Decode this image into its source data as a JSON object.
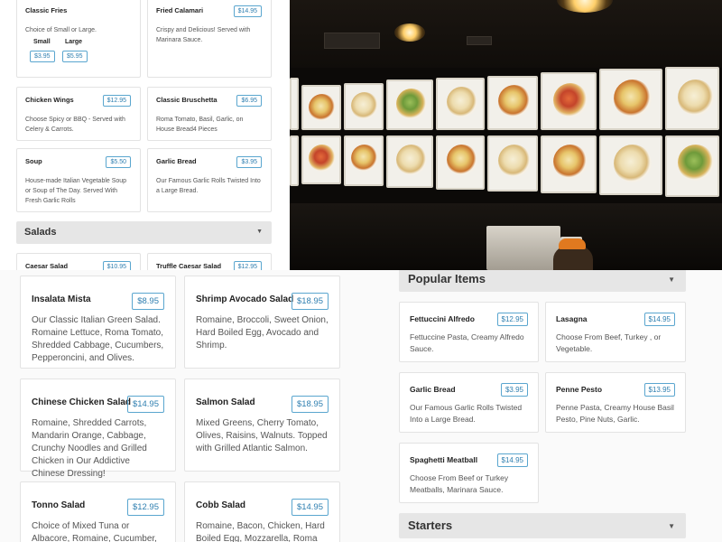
{
  "top_left": {
    "cards": [
      {
        "name": "Classic Fries",
        "price": "",
        "desc": "Choice of Small or Large.",
        "sizes": [
          {
            "label": "Small",
            "price": "$3.95"
          },
          {
            "label": "Large",
            "price": "$5.95"
          }
        ]
      },
      {
        "name": "Fried Calamari",
        "price": "$14.95",
        "desc": "Crispy and Delicious! Served with Marinara Sauce."
      },
      {
        "name": "Chicken Wings",
        "price": "$12.95",
        "desc": "Choose Spicy or BBQ - Served with Celery & Carrots."
      },
      {
        "name": "Classic Bruschetta",
        "price": "$6.95",
        "desc": "Roma Tomato, Basil, Garlic, on House Bread4 Pieces"
      },
      {
        "name": "Soup",
        "price": "$5.50",
        "desc": "House-made Italian Vegetable Soup or Soup of The Day. Served With Fresh Garlic Rolls"
      },
      {
        "name": "Garlic Bread",
        "price": "$3.95",
        "desc": "Our Famous Garlic Rolls Twisted Into a Large Bread."
      },
      {
        "name": "Caesar Salad",
        "price": "$10.95",
        "desc": ""
      },
      {
        "name": "Truffle Caesar Salad",
        "price": "$12.95",
        "desc": ""
      }
    ],
    "section": {
      "label": "Salads",
      "chevron": "▼"
    }
  },
  "photo": {
    "description_icon": "restaurant-menu-board-photo"
  },
  "bottom_left": {
    "cards": [
      {
        "name": "Insalata Mista",
        "price": "$8.95",
        "desc": "Our Classic Italian Green Salad. Romaine Lettuce, Roma Tomato, Shredded Cabbage, Cucumbers, Pepperoncini, and Olives."
      },
      {
        "name": "Shrimp Avocado Salad",
        "price": "$18.95",
        "desc": "Romaine, Broccoli, Sweet Onion, Hard Boiled Egg, Avocado and Shrimp."
      },
      {
        "name": "Chinese Chicken Salad",
        "price": "$14.95",
        "desc": "Romaine, Shredded Carrots, Mandarin Orange, Cabbage, Crunchy Noodles and Grilled Chicken in Our Addictive Chinese Dressing!"
      },
      {
        "name": "Salmon Salad",
        "price": "$18.95",
        "desc": "Mixed Greens, Cherry Tomato, Olives, Raisins, Walnuts. Topped with Grilled Atlantic Salmon."
      },
      {
        "name": "Tonno Salad",
        "price": "$12.95",
        "desc": "Choice of Mixed Tuna or Albacore, Romaine, Cucumber, Tomatoes,"
      },
      {
        "name": "Cobb Salad",
        "price": "$14.95",
        "desc": "Romaine, Bacon, Chicken, Hard Boiled Egg, Mozzarella, Roma"
      }
    ]
  },
  "bottom_right": {
    "popular_section": {
      "label": "Popular Items",
      "chevron": "▼"
    },
    "cards": [
      {
        "name": "Fettuccini Alfredo",
        "price": "$12.95",
        "desc": "Fettuccine Pasta, Creamy Alfredo Sauce."
      },
      {
        "name": "Lasagna",
        "price": "$14.95",
        "desc": "Choose From Beef, Turkey , or Vegetable."
      },
      {
        "name": "Garlic Bread",
        "price": "$3.95",
        "desc": "Our Famous Garlic Rolls Twisted Into a Large Bread."
      },
      {
        "name": "Penne Pesto",
        "price": "$13.95",
        "desc": "Penne Pasta, Creamy House Basil Pesto, Pine Nuts, Garlic."
      },
      {
        "name": "Spaghetti Meatball",
        "price": "$14.95",
        "desc": "Choose From Beef or Turkey Meatballs, Marinara Sauce."
      }
    ],
    "starters_section": {
      "label": "Starters",
      "chevron": "▼"
    }
  },
  "colors": {
    "price_border": "#5aa6cf",
    "price_text": "#2f7fb0",
    "section_bar": "#e6e6e6"
  }
}
